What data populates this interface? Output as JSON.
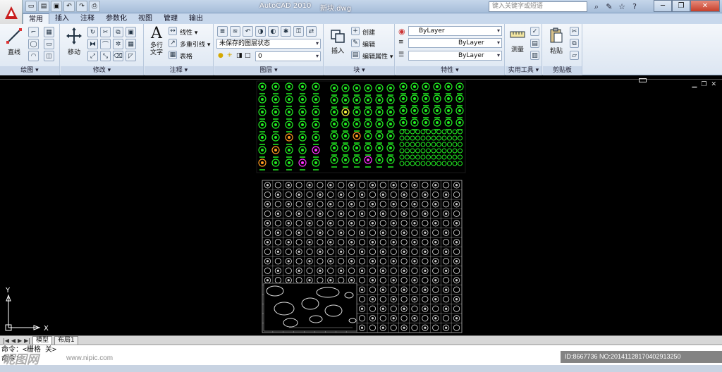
{
  "window": {
    "app_title": "AutoCAD 2010",
    "file_title": "新块.dwg"
  },
  "search": {
    "placeholder": "键入关键字或短语"
  },
  "tabs": [
    {
      "label": "常用",
      "active": true
    },
    {
      "label": "插入"
    },
    {
      "label": "注释"
    },
    {
      "label": "参数化"
    },
    {
      "label": "视图"
    },
    {
      "label": "管理"
    },
    {
      "label": "输出"
    }
  ],
  "ribbon": {
    "draw": {
      "label": "绘图",
      "line_label": "直线"
    },
    "modify": {
      "label": "修改",
      "move_label": "移动"
    },
    "annotation": {
      "label": "注释",
      "mtext_label": "多行\n文字",
      "linear_label": "线性",
      "mleader_label": "多重引线",
      "table_label": "表格"
    },
    "layers": {
      "label": "图层",
      "state_value": "未保存的图层状态",
      "layer_value": "0"
    },
    "block": {
      "label": "块",
      "insert_label": "插入",
      "create_label": "创建",
      "edit_label": "编辑",
      "edit_attr_label": "编辑属性"
    },
    "properties": {
      "label": "特性",
      "color_value": "ByLayer",
      "linetype_value": "ByLayer",
      "lineweight_value": "ByLayer"
    },
    "utilities": {
      "label": "实用工具",
      "measure_label": "测量"
    },
    "clipboard": {
      "label": "剪贴板",
      "paste_label": "粘贴"
    }
  },
  "layout_tabs": [
    {
      "label": "模型",
      "active": true
    },
    {
      "label": "布局1"
    }
  ],
  "axis": {
    "x_label": "X",
    "y_label": "Y"
  },
  "command_lines": [
    "命令：<栅格 关>",
    "命令："
  ],
  "watermark": {
    "brand": "昵图网",
    "url": "www.nipic.com",
    "id_text": "ID:8667736 NO:20141128170402913250"
  },
  "colors": {
    "ribbon_bg": "#dce6f2",
    "canvas": "#000000",
    "green_blocks": "#22ee22",
    "grid_lines": "#bbbbbb"
  }
}
